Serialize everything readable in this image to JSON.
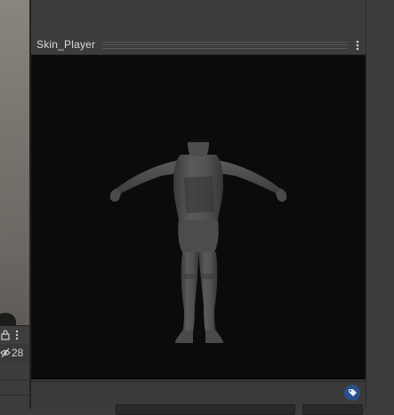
{
  "window": {
    "title": "Skin_Player"
  },
  "scene_panel": {
    "hidden_count": "28",
    "icons": [
      "lock-icon",
      "more-icon",
      "eye-slash-icon"
    ]
  },
  "preview": {
    "background_color": "#0b0b0b",
    "model_color": "#505050",
    "icons": [
      "kebab-menu-icon",
      "tag-icon"
    ]
  }
}
